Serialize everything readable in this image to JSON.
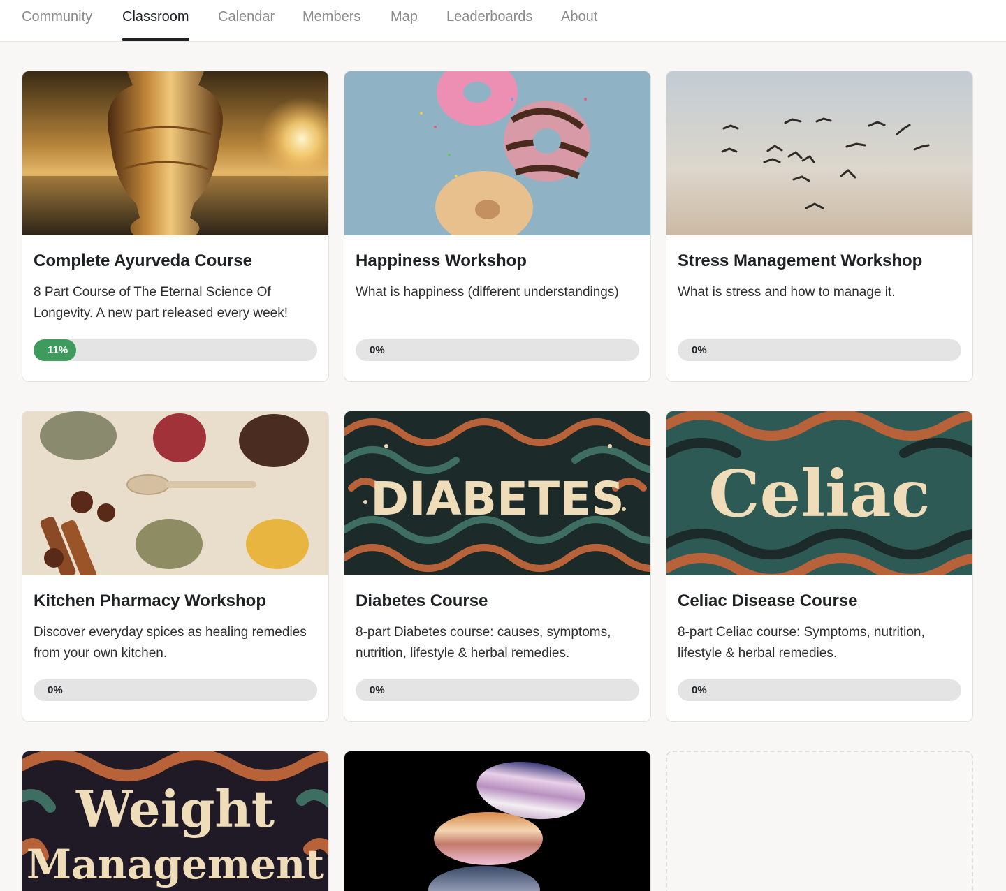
{
  "nav": {
    "tabs": [
      {
        "label": "Community"
      },
      {
        "label": "Classroom",
        "active": true
      },
      {
        "label": "Calendar"
      },
      {
        "label": "Members"
      },
      {
        "label": "Map"
      },
      {
        "label": "Leaderboards"
      },
      {
        "label": "About"
      }
    ]
  },
  "colors": {
    "progress_fill": "#3f9b5d",
    "progress_track": "#e4e4e4",
    "page_background": "#f8f7f5"
  },
  "courses": [
    {
      "title": "Complete Ayurveda Course",
      "description": "8 Part Course of The Eternal Science Of Longevity. A new part released every week!",
      "progress": 11,
      "progress_label": "11%",
      "image": "golden vase at sunset over sea"
    },
    {
      "title": "Happiness Workshop",
      "description": "What is happiness (different understandings)",
      "progress": 0,
      "progress_label": "0%",
      "image": "frosted donuts with sprinkles"
    },
    {
      "title": "Stress Management Workshop",
      "description": "What is stress and how to manage it.",
      "progress": 0,
      "progress_label": "0%",
      "image": "flock of birds in cloudy sky"
    },
    {
      "title": "Kitchen Pharmacy Workshop",
      "description": "Discover everyday spices as healing remedies from your own kitchen.",
      "progress": 0,
      "progress_label": "0%",
      "image": "spices on wooden board"
    },
    {
      "title": "Diabetes Course",
      "description": "8-part Diabetes course: causes, symptoms, nutrition, lifestyle & herbal remedies.",
      "progress": 0,
      "progress_label": "0%",
      "image_text": "DIABETES"
    },
    {
      "title": "Celiac Disease Course",
      "description": "8-part Celiac course: Symptoms, nutrition, lifestyle & herbal remedies.",
      "progress": 0,
      "progress_label": "0%",
      "image_text": "Celiac"
    },
    {
      "image_text_line1": "Weight",
      "image_text_line2": "Management"
    },
    {
      "image": "stacked gradient stones on black"
    }
  ]
}
